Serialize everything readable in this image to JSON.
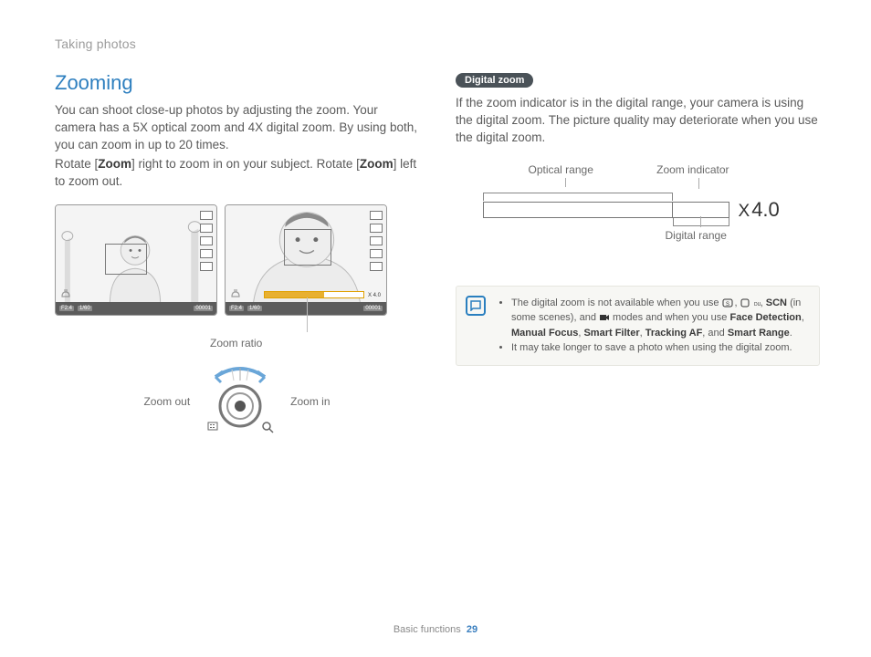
{
  "breadcrumb": "Taking photos",
  "left": {
    "heading": "Zooming",
    "p1_a": "You can shoot close-up photos by adjusting the zoom. Your camera has a 5X optical zoom and 4X digital zoom. By using both, you can zoom in up to 20 times.",
    "p2_a": "Rotate [",
    "p2_b": "Zoom",
    "p2_c": "] right to zoom in on your subject. Rotate [",
    "p2_d": "Zoom",
    "p2_e": "] left to zoom out.",
    "status": {
      "f": "F2.4",
      "s": "1/60",
      "n": "00001"
    },
    "zoom_ratio_value": "X 4.0",
    "label_zoom_ratio": "Zoom ratio",
    "label_zoom_out": "Zoom out",
    "label_zoom_in": "Zoom in"
  },
  "right": {
    "pill": "Digital zoom",
    "p1": "If the zoom indicator is in the digital range, your camera is using the digital zoom. The picture quality may deteriorate when you use the digital zoom.",
    "label_optical": "Optical range",
    "label_indicator": "Zoom indicator",
    "label_digital": "Digital range",
    "x_value": "4.0",
    "note1_a": "The digital zoom is not available when you use ",
    "note1_b": " (in some scenes), and ",
    "note1_c": " modes and when you use ",
    "note1_d": "Face Detection",
    "note1_e": ", ",
    "note1_f": "Manual Focus",
    "note1_g": ", ",
    "note1_h": "Smart Filter",
    "note1_i": ", ",
    "note1_j": "Tracking AF",
    "note1_k": ", and ",
    "note1_l": "Smart Range",
    "note1_m": ".",
    "scn_label": "SCN",
    "note2": "It may take longer to save a photo when using the digital zoom."
  },
  "footer": {
    "section": "Basic functions",
    "page": "29"
  },
  "chart_data": {
    "type": "bar",
    "title": "Zoom range indicator",
    "categories": [
      "Optical range",
      "Digital range"
    ],
    "values": [
      5,
      4
    ],
    "annotations": {
      "zoom_indicator_value": 4.0,
      "total_max_zoom": 20
    },
    "units": "zoom factor (×)"
  }
}
